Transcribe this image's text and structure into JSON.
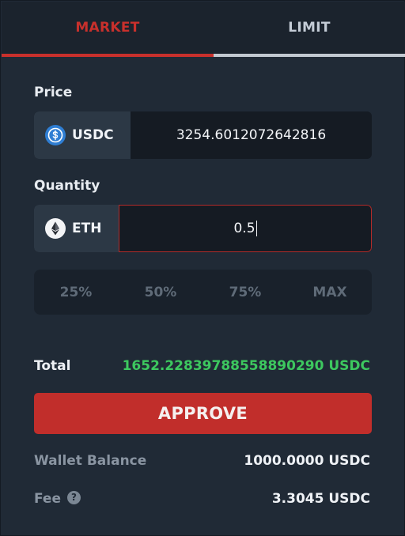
{
  "tabs": {
    "market": "MARKET",
    "limit": "LIMIT",
    "active": "market"
  },
  "price": {
    "label": "Price",
    "token": "USDC",
    "token_icon": "usdc-coin-icon",
    "value": "3254.6012072642816"
  },
  "quantity": {
    "label": "Quantity",
    "token": "ETH",
    "token_icon": "eth-coin-icon",
    "value": "0.5"
  },
  "percent_buttons": [
    "25%",
    "50%",
    "75%",
    "MAX"
  ],
  "total": {
    "label": "Total",
    "value": "1652.22839788558890290 USDC"
  },
  "approve_label": "APPROVE",
  "wallet_balance": {
    "label": "Wallet Balance",
    "value": "1000.0000 USDC"
  },
  "fee": {
    "label": "Fee",
    "help_icon": "question-circle-icon",
    "value": "3.3045 USDC"
  },
  "colors": {
    "accent_red": "#c12e2b",
    "total_green": "#3dc85f",
    "background": "#202a36"
  }
}
